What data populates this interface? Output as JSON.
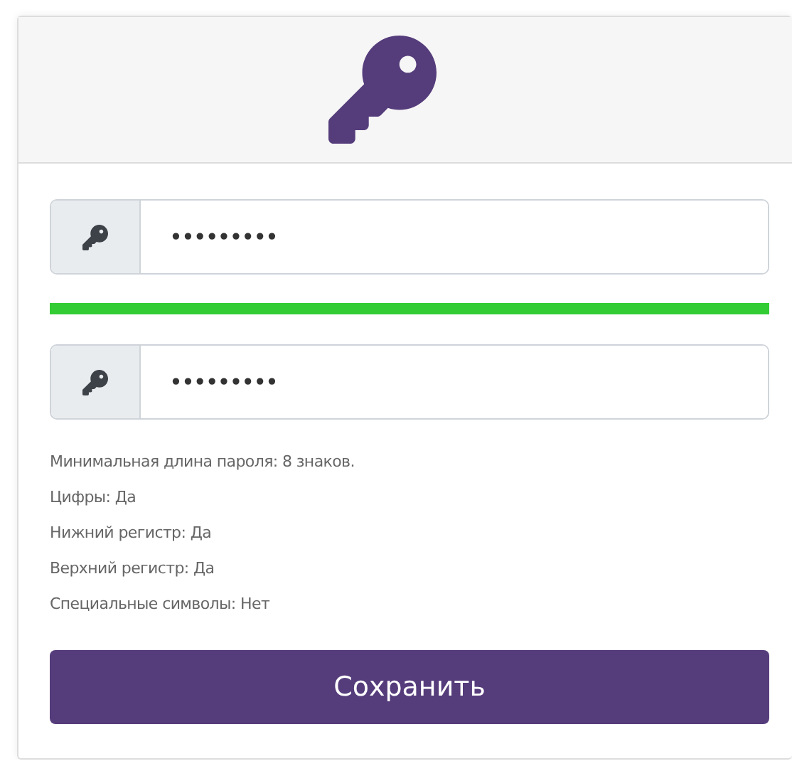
{
  "fields": [
    {
      "kind": "password",
      "value": "•••••••••"
    },
    {
      "kind": "meter",
      "level": 1,
      "color": "#33cc33"
    },
    {
      "kind": "password",
      "value": "•••••••••"
    }
  ],
  "rules": [
    "Минимальная длина пароля: 8 знаков.",
    "Цифры: Да",
    "Нижний регистр: Да",
    "Верхний регистр: Да",
    "Специальные символы: Нет"
  ],
  "save_button": "Сохранить"
}
